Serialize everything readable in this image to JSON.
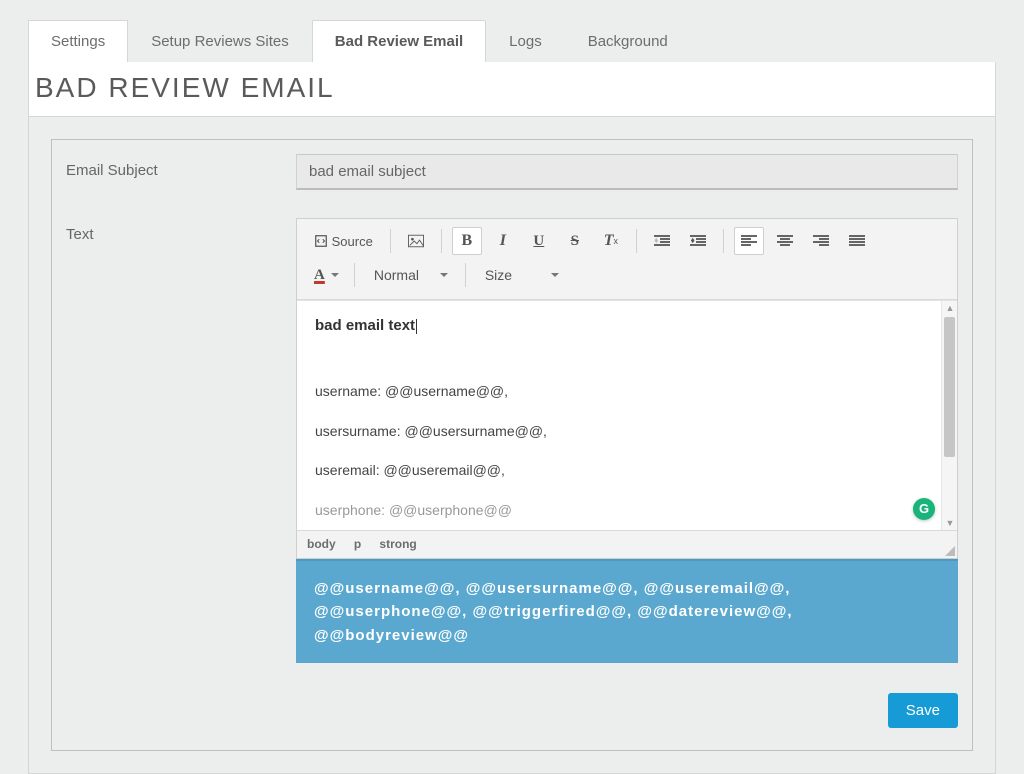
{
  "tabs": {
    "settings": "Settings",
    "setup": "Setup Reviews Sites",
    "bad_review": "Bad Review Email",
    "logs": "Logs",
    "background": "Background"
  },
  "page_title": "BAD REVIEW EMAIL",
  "labels": {
    "email_subject": "Email Subject",
    "text": "Text"
  },
  "subject_value": "bad email subject",
  "toolbar": {
    "source": "Source",
    "format_value": "Normal",
    "size_value": "Size"
  },
  "editor": {
    "bold_line": "bad email text",
    "body_lines": [
      "username: @@username@@,",
      "usersurname: @@usersurname@@,",
      "useremail: @@useremail@@,",
      "userphone: @@userphone@@"
    ],
    "path": [
      "body",
      "p",
      "strong"
    ]
  },
  "placeholders_text": "@@username@@, @@usersurname@@, @@useremail@@, @@userphone@@, @@triggerfired@@, @@datereview@@, @@bodyreview@@",
  "buttons": {
    "save": "Save"
  },
  "icons": {
    "grammarly": "G"
  }
}
